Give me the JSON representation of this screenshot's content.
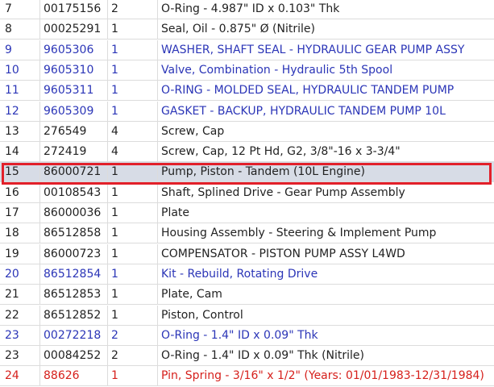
{
  "colors": {
    "link": "#2b35b7",
    "text": "#222222",
    "alert": "#d6201c",
    "highlight_border": "#e2202a",
    "selected_row": "#d7dce6"
  },
  "rows": [
    {
      "ref": "7",
      "part": "00175156",
      "qty": "2",
      "desc": "O-Ring - 4.987\" ID x 0.103\" Thk",
      "color": "black"
    },
    {
      "ref": "8",
      "part": "00025291",
      "qty": "1",
      "desc": "Seal, Oil - 0.875\" Ø (Nitrile)",
      "color": "black"
    },
    {
      "ref": "9",
      "part": "9605306",
      "qty": "1",
      "desc": "WASHER, SHAFT SEAL - HYDRAULIC GEAR PUMP ASSY",
      "color": "blue"
    },
    {
      "ref": "10",
      "part": "9605310",
      "qty": "1",
      "desc": "Valve, Combination - Hydraulic 5th Spool",
      "color": "blue"
    },
    {
      "ref": "11",
      "part": "9605311",
      "qty": "1",
      "desc": "O-RING - MOLDED SEAL, HYDRAULIC TANDEM PUMP",
      "color": "blue"
    },
    {
      "ref": "12",
      "part": "9605309",
      "qty": "1",
      "desc": "GASKET - BACKUP, HYDRAULIC TANDEM PUMP 10L",
      "color": "blue"
    },
    {
      "ref": "13",
      "part": "276549",
      "qty": "4",
      "desc": "Screw, Cap",
      "color": "black"
    },
    {
      "ref": "14",
      "part": "272419",
      "qty": "4",
      "desc": "Screw, Cap, 12 Pt Hd, G2, 3/8\"-16 x 3-3/4\"",
      "color": "black"
    },
    {
      "ref": "15",
      "part": "86000721",
      "qty": "1",
      "desc": "Pump, Piston - Tandem (10L Engine)",
      "color": "black",
      "selected": true
    },
    {
      "ref": "16",
      "part": "00108543",
      "qty": "1",
      "desc": "Shaft, Splined Drive - Gear Pump Assembly",
      "color": "black"
    },
    {
      "ref": "17",
      "part": "86000036",
      "qty": "1",
      "desc": "Plate",
      "color": "black"
    },
    {
      "ref": "18",
      "part": "86512858",
      "qty": "1",
      "desc": "Housing Assembly - Steering & Implement Pump",
      "color": "black"
    },
    {
      "ref": "19",
      "part": "86000723",
      "qty": "1",
      "desc": "COMPENSATOR - PISTON PUMP ASSY L4WD",
      "color": "black"
    },
    {
      "ref": "20",
      "part": "86512854",
      "qty": "1",
      "desc": "Kit - Rebuild, Rotating Drive",
      "color": "blue"
    },
    {
      "ref": "21",
      "part": "86512853",
      "qty": "1",
      "desc": "Plate, Cam",
      "color": "black"
    },
    {
      "ref": "22",
      "part": "86512852",
      "qty": "1",
      "desc": "Piston, Control",
      "color": "black"
    },
    {
      "ref": "23",
      "part": "00272218",
      "qty": "2",
      "desc": "O-Ring - 1.4\" ID x 0.09\" Thk",
      "color": "blue"
    },
    {
      "ref": "23",
      "part": "00084252",
      "qty": "2",
      "desc": "O-Ring - 1.4\" ID x 0.09\" Thk (Nitrile)",
      "color": "black"
    },
    {
      "ref": "24",
      "part": "88626",
      "qty": "1",
      "desc": "Pin, Spring - 3/16\" x 1/2\" (Years: 01/01/1983-12/31/1984)",
      "color": "red"
    }
  ]
}
